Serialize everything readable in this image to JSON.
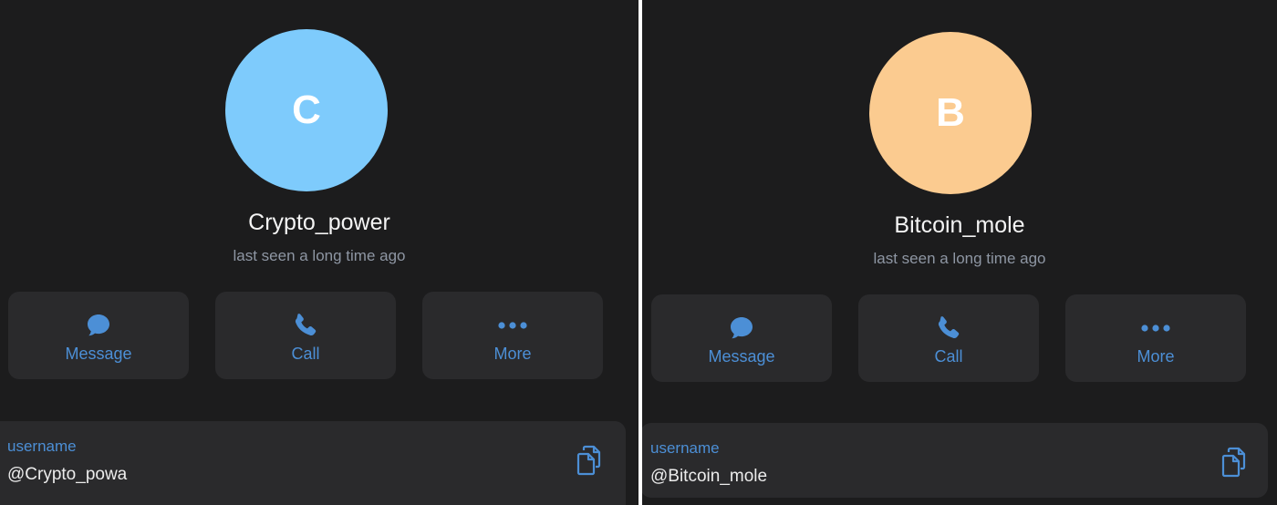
{
  "profiles": [
    {
      "initial": "C",
      "avatar_color": "#7ecbfc",
      "name": "Crypto_power",
      "status": "last seen a long time ago",
      "actions": [
        {
          "label": "Message",
          "icon": "chat-bubble-icon"
        },
        {
          "label": "Call",
          "icon": "phone-icon"
        },
        {
          "label": "More",
          "icon": "more-dots-icon"
        }
      ],
      "info": {
        "label": "username",
        "value": "@Crypto_powa",
        "icon": "copy-icon"
      }
    },
    {
      "initial": "B",
      "avatar_color": "#fbcb90",
      "name": "Bitcoin_mole",
      "status": "last seen a long time ago",
      "actions": [
        {
          "label": "Message",
          "icon": "chat-bubble-icon"
        },
        {
          "label": "Call",
          "icon": "phone-icon"
        },
        {
          "label": "More",
          "icon": "more-dots-icon"
        }
      ],
      "info": {
        "label": "username",
        "value": "@Bitcoin_mole",
        "icon": "copy-icon"
      }
    }
  ],
  "colors": {
    "background": "#1c1c1d",
    "card": "#2a2a2c",
    "accent": "#4c8fd6",
    "status_text": "#8e96a3"
  }
}
